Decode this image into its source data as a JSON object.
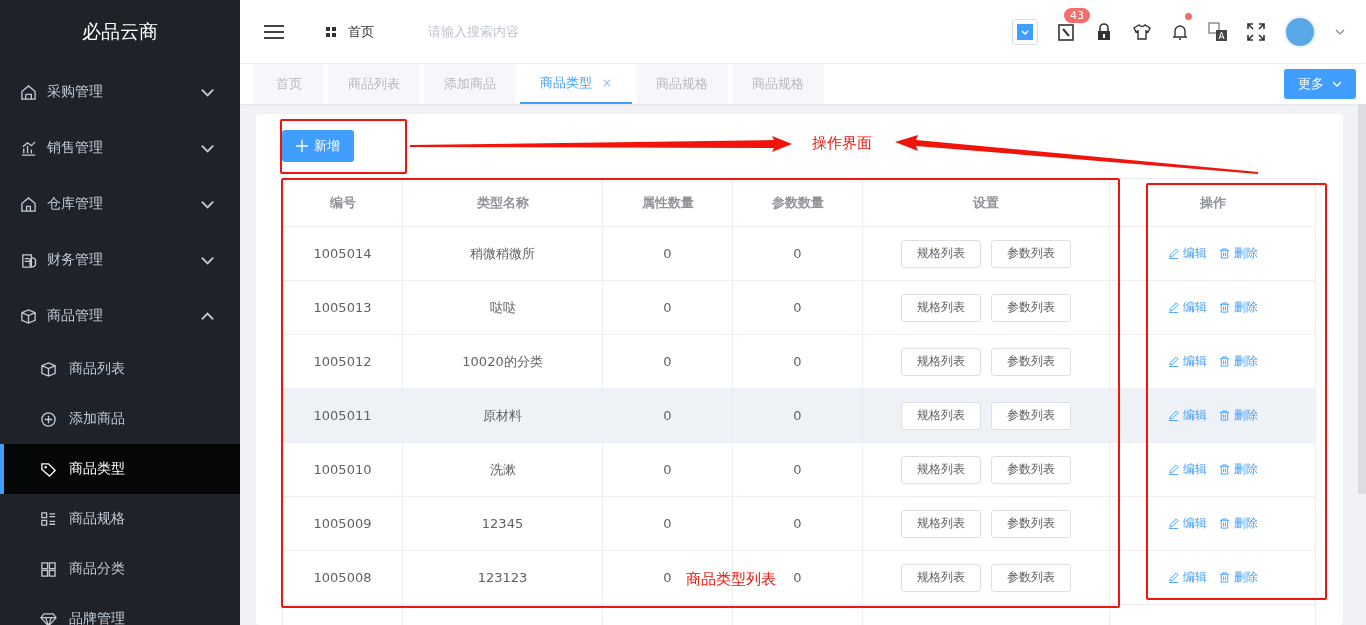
{
  "sidebar": {
    "logo": "必品云商",
    "items": [
      {
        "label": "采购管理",
        "expanded": false
      },
      {
        "label": "销售管理",
        "expanded": false
      },
      {
        "label": "仓库管理",
        "expanded": false
      },
      {
        "label": "财务管理",
        "expanded": false
      },
      {
        "label": "商品管理",
        "expanded": true,
        "children": [
          {
            "label": "商品列表",
            "selected": false
          },
          {
            "label": "添加商品",
            "selected": false
          },
          {
            "label": "商品类型",
            "selected": true
          },
          {
            "label": "商品规格",
            "selected": false
          },
          {
            "label": "商品分类",
            "selected": false
          },
          {
            "label": "品牌管理",
            "selected": false
          }
        ]
      }
    ]
  },
  "header": {
    "breadcrumb": "首页",
    "search": {
      "placeholder": "请输入搜索内容"
    },
    "badge": "43",
    "bell_dot": true
  },
  "tabs": [
    {
      "label": "首页",
      "selected": false
    },
    {
      "label": "商品列表",
      "selected": false
    },
    {
      "label": "添加商品",
      "selected": false
    },
    {
      "label": "商品类型",
      "selected": true,
      "close": "×"
    },
    {
      "label": "商品规格",
      "selected": false
    },
    {
      "label": "商品规格",
      "selected": false
    }
  ],
  "more_button": "更多",
  "add_button": "新增",
  "table": {
    "columns": [
      "编号",
      "类型名称",
      "属性数量",
      "参数数量",
      "设置",
      "操作"
    ],
    "rows": [
      {
        "id": "1005014",
        "name": "稍微稍微所",
        "attrs": "0",
        "params": "0",
        "settings": [
          "规格列表",
          "参数列表"
        ],
        "actions": [
          "编辑",
          "删除"
        ],
        "highlighted": false
      },
      {
        "id": "1005013",
        "name": "哒哒",
        "attrs": "0",
        "params": "0",
        "settings": [
          "规格列表",
          "参数列表"
        ],
        "actions": [
          "编辑",
          "删除"
        ],
        "highlighted": false
      },
      {
        "id": "1005012",
        "name": "10020的分类",
        "attrs": "0",
        "params": "0",
        "settings": [
          "规格列表",
          "参数列表"
        ],
        "actions": [
          "编辑",
          "删除"
        ],
        "highlighted": false
      },
      {
        "id": "1005011",
        "name": "原材料",
        "attrs": "0",
        "params": "0",
        "settings": [
          "规格列表",
          "参数列表"
        ],
        "actions": [
          "编辑",
          "删除"
        ],
        "highlighted": true
      },
      {
        "id": "1005010",
        "name": "洗漱",
        "attrs": "0",
        "params": "0",
        "settings": [
          "规格列表",
          "参数列表"
        ],
        "actions": [
          "编辑",
          "删除"
        ],
        "highlighted": false
      },
      {
        "id": "1005009",
        "name": "12345",
        "attrs": "0",
        "params": "0",
        "settings": [
          "规格列表",
          "参数列表"
        ],
        "actions": [
          "编辑",
          "删除"
        ],
        "highlighted": false
      },
      {
        "id": "1005008",
        "name": "123123",
        "attrs": "0",
        "params": "0",
        "settings": [
          "规格列表",
          "参数列表"
        ],
        "actions": [
          "编辑",
          "删除"
        ],
        "highlighted": false
      }
    ]
  },
  "annotations": [
    {
      "text": "操作界面"
    },
    {
      "text": "商品类型列表"
    }
  ]
}
